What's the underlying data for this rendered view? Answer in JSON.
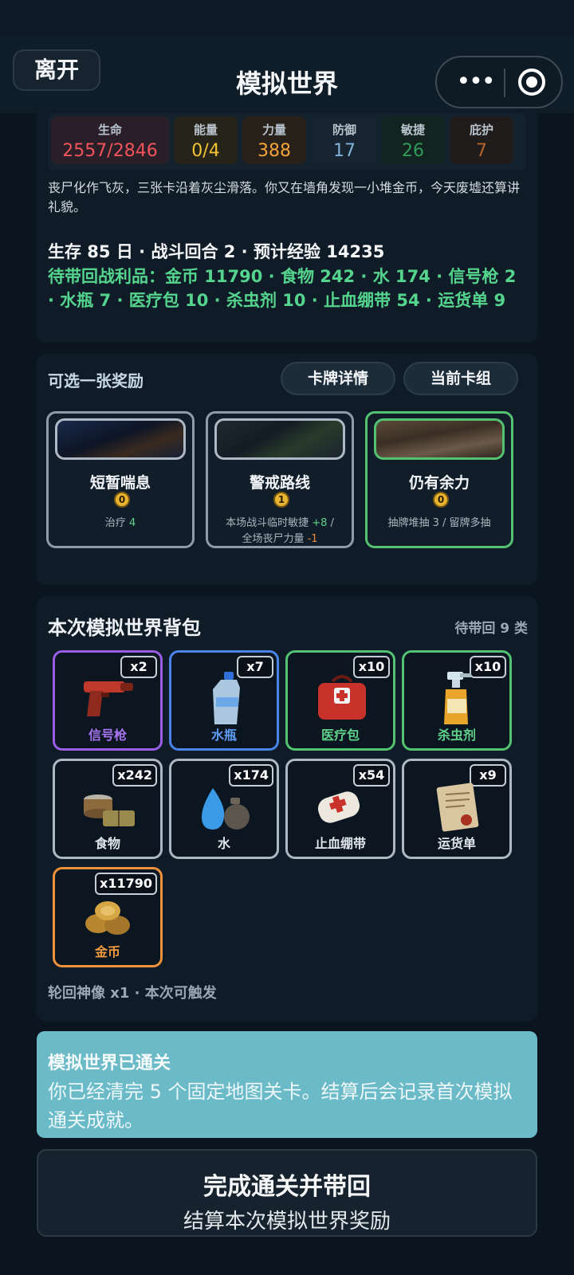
{
  "header": {
    "leave_label": "离开",
    "title": "模拟世界"
  },
  "stats": [
    {
      "label": "生命",
      "value": "2557/2846",
      "color": "#f0545a"
    },
    {
      "label": "能量",
      "value": "0/4",
      "color": "#f1c232"
    },
    {
      "label": "力量",
      "value": "388",
      "color": "#f2a33a"
    },
    {
      "label": "防御",
      "value": "17",
      "color": "#7fb2d8"
    },
    {
      "label": "敏捷",
      "value": "26",
      "color": "#2f9a5a"
    },
    {
      "label": "庇护",
      "value": "7",
      "color": "#b7642c"
    }
  ],
  "narrative": "丧尸化作飞灰，三张卡沿着灰尘滑落。你又在墙角发现一小堆金币，今天废墟还算讲礼貌。",
  "summary": "生存 85 日 · 战斗回合 2 · 预计经验 14235",
  "loot": "待带回战利品：金币 11790 · 食物 242 · 水 174 · 信号枪 2 · 水瓶 7 · 医疗包 10 · 杀虫剂 10 · 止血绷带 54 · 运货单 9",
  "reward": {
    "title": "可选一张奖励",
    "details_button": "卡牌详情",
    "deck_button": "当前卡组",
    "cards": [
      {
        "name": "短暂喘息",
        "cost": "0",
        "desc_text": "治疗",
        "desc_value": "4",
        "border": "#8e9baa"
      },
      {
        "name": "警戒路线",
        "cost": "1",
        "desc_line1_text": "本场战斗临时敏捷",
        "desc_line1_value": "+8",
        "desc_line1_suffix": "/",
        "desc_line2_text": "全场丧尸力量",
        "desc_line2_value": "-1",
        "border": "#8e9baa"
      },
      {
        "name": "仍有余力",
        "cost": "0",
        "desc": "抽牌堆抽 3 / 留牌多抽",
        "border": "#54c271"
      }
    ]
  },
  "bag": {
    "title": "本次模拟世界背包",
    "count": "待带回 9 类",
    "items": [
      {
        "name": "信号枪",
        "qty": "x2",
        "icon": "flare-gun-icon",
        "border": "#9b5de5",
        "name_color": "#a875f0"
      },
      {
        "name": "水瓶",
        "qty": "x7",
        "icon": "water-bottle-icon",
        "border": "#4a84e8",
        "name_color": "#5f9bf5"
      },
      {
        "name": "医疗包",
        "qty": "x10",
        "icon": "medkit-icon",
        "border": "#54c271",
        "name_color": "#5fd18b"
      },
      {
        "name": "杀虫剂",
        "qty": "x10",
        "icon": "insecticide-icon",
        "border": "#54c271",
        "name_color": "#5fd18b"
      },
      {
        "name": "食物",
        "qty": "x242",
        "icon": "food-icon",
        "border": "#aeb8c4",
        "name_color": "#dfe5eb"
      },
      {
        "name": "水",
        "qty": "x174",
        "icon": "water-icon",
        "border": "#aeb8c4",
        "name_color": "#dfe5eb"
      },
      {
        "name": "止血绷带",
        "qty": "x54",
        "icon": "bandage-icon",
        "border": "#aeb8c4",
        "name_color": "#dfe5eb"
      },
      {
        "name": "运货单",
        "qty": "x9",
        "icon": "waybill-icon",
        "border": "#aeb8c4",
        "name_color": "#dfe5eb"
      },
      {
        "name": "金币",
        "qty": "x11790",
        "icon": "gold-coins-icon",
        "border": "#f0923a",
        "name_color": "#f29a3d"
      }
    ],
    "footer": "轮回神像 x1 · 本次可触发"
  },
  "clear_notice": {
    "title": "模拟世界已通关",
    "text": "你已经清完 5 个固定地图关卡。结算后会记录首次模拟通关成就。"
  },
  "finish_button": {
    "title": "完成通关并带回",
    "subtitle": "结算本次模拟世界奖励"
  }
}
